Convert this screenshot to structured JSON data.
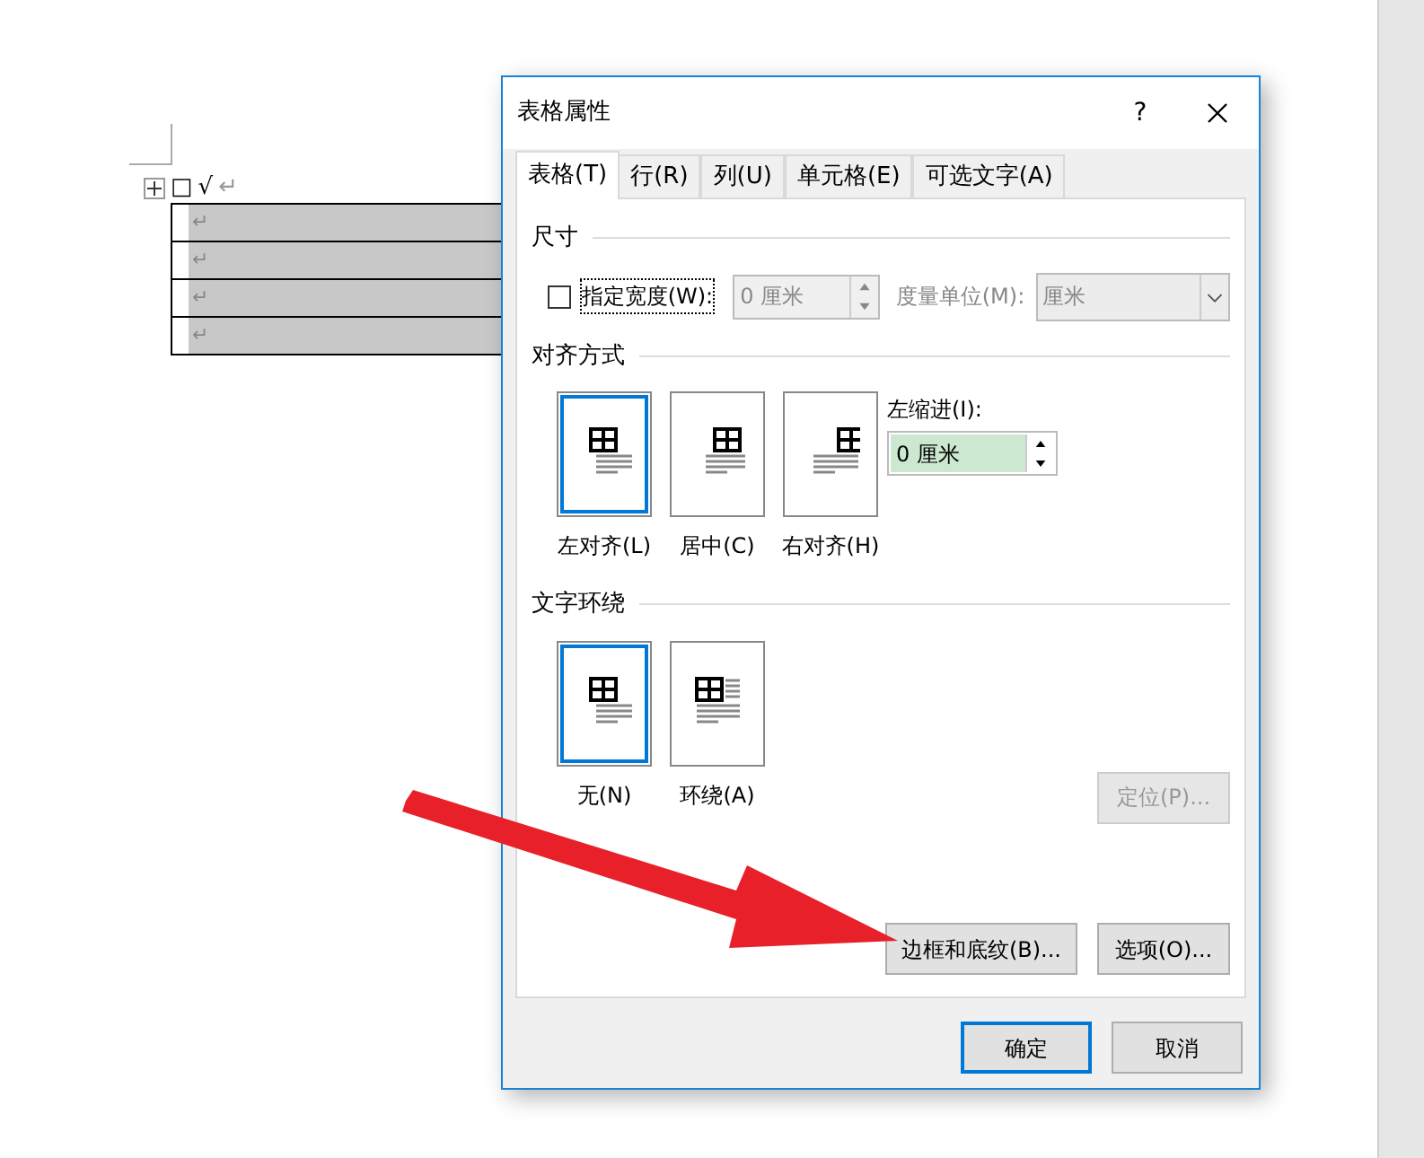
{
  "document": {
    "first_line": {
      "box": "□",
      "check": "√",
      "mark": "↵"
    },
    "table_rows": [
      {
        "cell": "↵"
      },
      {
        "cell": "↵"
      },
      {
        "cell": "↵"
      },
      {
        "cell": "↵"
      }
    ]
  },
  "dialog": {
    "title": "表格属性",
    "help": "?",
    "tabs": [
      {
        "label": "表格(T)",
        "selected": true
      },
      {
        "label": "行(R)",
        "selected": false
      },
      {
        "label": "列(U)",
        "selected": false
      },
      {
        "label": "单元格(E)",
        "selected": false
      },
      {
        "label": "可选文字(A)",
        "selected": false
      }
    ],
    "size": {
      "heading": "尺寸",
      "width_checkbox": {
        "label": "指定宽度(W):",
        "checked": false
      },
      "width_field": {
        "value": "0 厘米",
        "disabled": true
      },
      "unit_label": "度量单位(M):",
      "unit_select": {
        "value": "厘米",
        "disabled": true
      }
    },
    "alignment": {
      "heading": "对齐方式",
      "options": [
        {
          "label": "左对齐(L)",
          "kind": "left",
          "selected": true
        },
        {
          "label": "居中(C)",
          "kind": "center",
          "selected": false
        },
        {
          "label": "右对齐(H)",
          "kind": "right",
          "selected": false
        }
      ],
      "indent_label": "左缩进(I):",
      "indent_field": {
        "value": "0 厘米"
      }
    },
    "wrapping": {
      "heading": "文字环绕",
      "options": [
        {
          "label": "无(N)",
          "kind": "none",
          "selected": true
        },
        {
          "label": "环绕(A)",
          "kind": "around",
          "selected": false
        }
      ],
      "position_button": {
        "label": "定位(P)...",
        "disabled": true
      }
    },
    "panel_buttons": [
      "边框和底纹(B)...",
      "选项(O)..."
    ],
    "footer_buttons": [
      {
        "label": "确定",
        "default": true
      },
      {
        "label": "取消",
        "default": false
      }
    ]
  }
}
